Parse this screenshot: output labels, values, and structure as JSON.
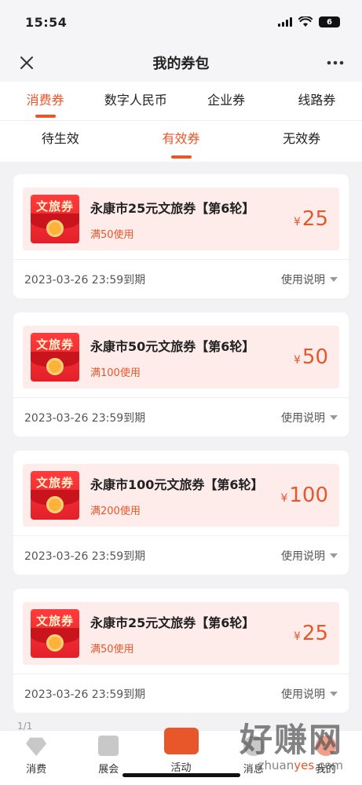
{
  "status_bar": {
    "time": "15:54",
    "battery": "6"
  },
  "nav": {
    "title": "我的券包"
  },
  "main_tabs": [
    {
      "label": "消费券",
      "active": true
    },
    {
      "label": "数字人民币",
      "active": false
    },
    {
      "label": "企业券",
      "active": false
    },
    {
      "label": "线路券",
      "active": false
    }
  ],
  "sub_tabs": [
    {
      "label": "待生效",
      "active": false
    },
    {
      "label": "有效券",
      "active": true
    },
    {
      "label": "无效券",
      "active": false
    }
  ],
  "coupons": [
    {
      "thumb": "文旅券",
      "name": "永康市25元文旅券【第6轮】",
      "condition": "满50使用",
      "currency": "¥",
      "amount": "25",
      "expire": "2023-03-26 23:59到期",
      "usage": "使用说明"
    },
    {
      "thumb": "文旅券",
      "name": "永康市50元文旅券【第6轮】",
      "condition": "满100使用",
      "currency": "¥",
      "amount": "50",
      "expire": "2023-03-26 23:59到期",
      "usage": "使用说明"
    },
    {
      "thumb": "文旅券",
      "name": "永康市100元文旅券【第6轮】",
      "condition": "满200使用",
      "currency": "¥",
      "amount": "100",
      "expire": "2023-03-26 23:59到期",
      "usage": "使用说明"
    },
    {
      "thumb": "文旅券",
      "name": "永康市25元文旅券【第6轮】",
      "condition": "满50使用",
      "currency": "¥",
      "amount": "25",
      "expire": "2023-03-26 23:59到期",
      "usage": "使用说明"
    }
  ],
  "page_indicator": "1/1",
  "bottom_nav": [
    {
      "label": "消费",
      "icon": "diamond-icon"
    },
    {
      "label": "展会",
      "icon": "ticket-icon"
    },
    {
      "label": "活动",
      "icon": "gift-icon"
    },
    {
      "label": "消息",
      "icon": "message-icon"
    },
    {
      "label": "我的",
      "icon": "profile-icon"
    }
  ],
  "watermark": {
    "main": "好赚网",
    "sub_a": "zhuan",
    "sub_b": "yes",
    "sub_c": ".com"
  },
  "colors": {
    "accent": "#e8572a",
    "card_bg": "#fdecea"
  }
}
